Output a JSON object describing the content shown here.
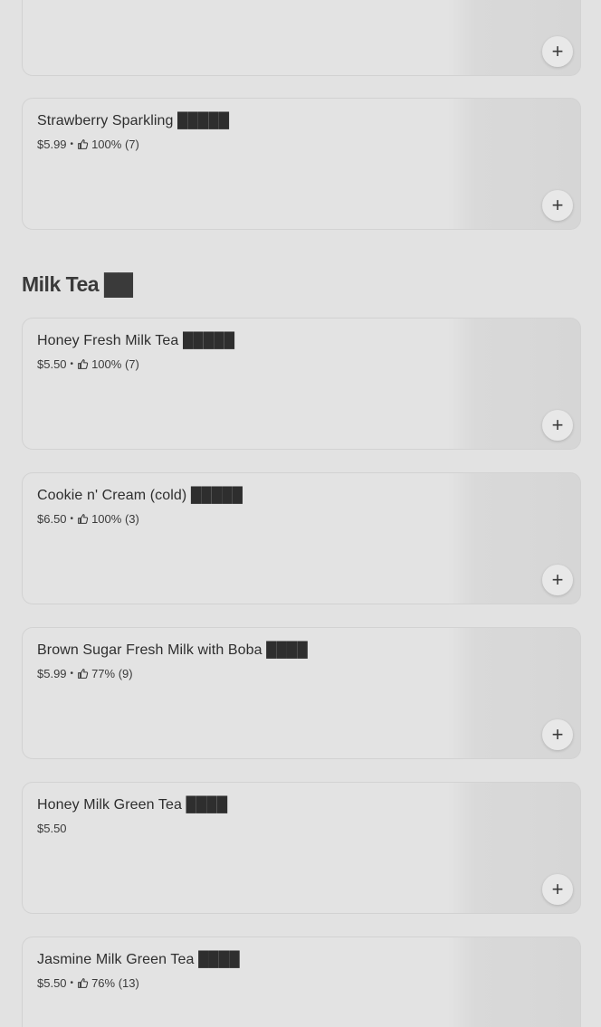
{
  "add_label": "+",
  "items_top": [
    {
      "name": "",
      "price": "",
      "rating": "",
      "reviews": ""
    },
    {
      "name": "Strawberry Sparkling █████",
      "price": "$5.99",
      "rating": "100%",
      "reviews": "(7)"
    }
  ],
  "section": {
    "title": "Milk Tea ██"
  },
  "milk_tea": [
    {
      "name": "Honey Fresh Milk Tea █████",
      "price": "$5.50",
      "rating": "100%",
      "reviews": "(7)"
    },
    {
      "name": "Cookie n' Cream (cold) █████",
      "price": "$6.50",
      "rating": "100%",
      "reviews": "(3)"
    },
    {
      "name": "Brown Sugar Fresh Milk with Boba ████",
      "price": "$5.99",
      "rating": "77%",
      "reviews": "(9)"
    },
    {
      "name": "Honey Milk Green Tea ████",
      "price": "$5.50",
      "rating": "",
      "reviews": ""
    },
    {
      "name": "Jasmine Milk Green Tea ████",
      "price": "$5.50",
      "rating": "76%",
      "reviews": "(13)"
    }
  ]
}
